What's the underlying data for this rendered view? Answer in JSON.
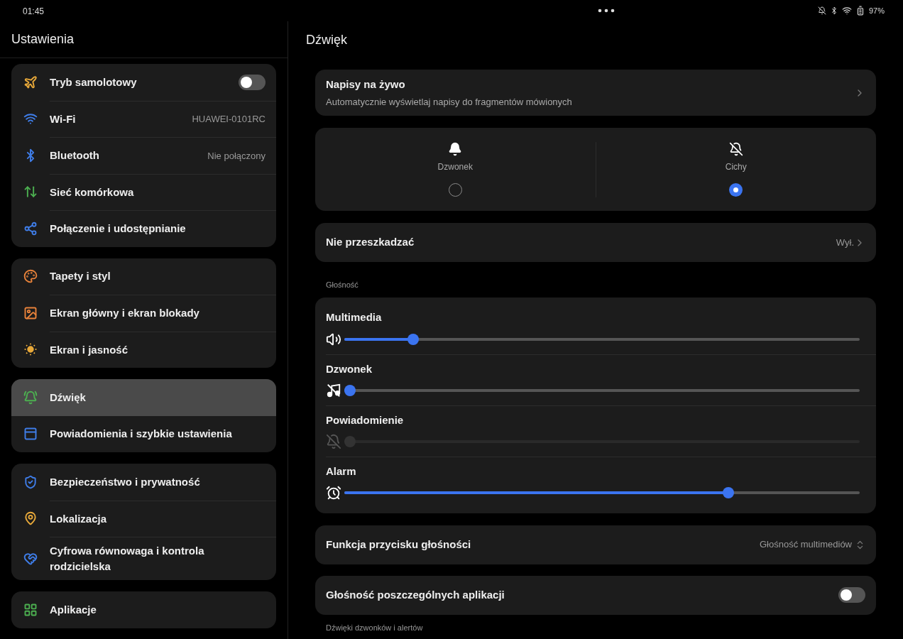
{
  "status_bar": {
    "time": "01:45",
    "battery": "97%"
  },
  "sidebar": {
    "title": "Ustawienia",
    "groups": [
      {
        "items": [
          {
            "color": "#e8a93a",
            "label": "Tryb samolotowy",
            "on": false,
            "selected": false
          },
          {
            "color": "#3f7de8",
            "label": "Wi-Fi",
            "value": "HUAWEI-0101RC",
            "selected": false
          },
          {
            "color": "#3f7de8",
            "label": "Bluetooth",
            "value": "Nie połączony",
            "selected": false
          },
          {
            "color": "#4caf50",
            "label": "Sieć komórkowa",
            "selected": false
          },
          {
            "color": "#3f7de8",
            "label": "Połączenie i udostępnianie",
            "selected": false
          }
        ]
      },
      {
        "items": [
          {
            "color": "#e8823a",
            "label": "Tapety i styl",
            "selected": false
          },
          {
            "color": "#e8823a",
            "label": "Ekran główny i ekran blokady",
            "selected": false
          },
          {
            "color": "#e8a93a",
            "label": "Ekran i jasność",
            "selected": false
          }
        ]
      },
      {
        "items": [
          {
            "color": "#4caf50",
            "label": "Dźwięk",
            "selected": true
          },
          {
            "color": "#3f7de8",
            "label": "Powiadomienia i szybkie ustawienia",
            "selected": false
          }
        ]
      },
      {
        "items": [
          {
            "color": "#3f7de8",
            "label": "Bezpieczeństwo i prywatność",
            "selected": false
          },
          {
            "color": "#e8a93a",
            "label": "Lokalizacja",
            "selected": false
          },
          {
            "color": "#3f7de8",
            "label": "Cyfrowa równowaga i kontrola rodzicielska",
            "selected": false
          }
        ]
      },
      {
        "items": [
          {
            "color": "#4caf50",
            "label": "Aplikacje",
            "selected": false
          }
        ]
      }
    ]
  },
  "page": {
    "title": "Dźwięk",
    "live_captions": {
      "title": "Napisy na żywo",
      "subtitle": "Automatycznie wyświetlaj napisy do fragmentów mówionych"
    },
    "modes": [
      {
        "label": "Dzwonek",
        "selected": false
      },
      {
        "label": "Cichy",
        "selected": true
      }
    ],
    "dnd": {
      "label": "Nie przeszkadzać",
      "value": "Wył."
    },
    "volume_label": "Głośność",
    "volumes": [
      {
        "label": "Multimedia",
        "level": 0.126,
        "disabled": false
      },
      {
        "label": "Dzwonek",
        "level": 0,
        "disabled": false
      },
      {
        "label": "Powiadomienie",
        "level": 0,
        "disabled": true
      },
      {
        "label": "Alarm",
        "level": 0.75,
        "disabled": false
      }
    ],
    "volume_button": {
      "label": "Funkcja przycisku głośności",
      "value": "Głośność multimediów"
    },
    "per_app": {
      "label": "Głośność poszczególnych aplikacji",
      "on": false
    },
    "next_section": "Dźwięki dzwonków i alertów"
  }
}
